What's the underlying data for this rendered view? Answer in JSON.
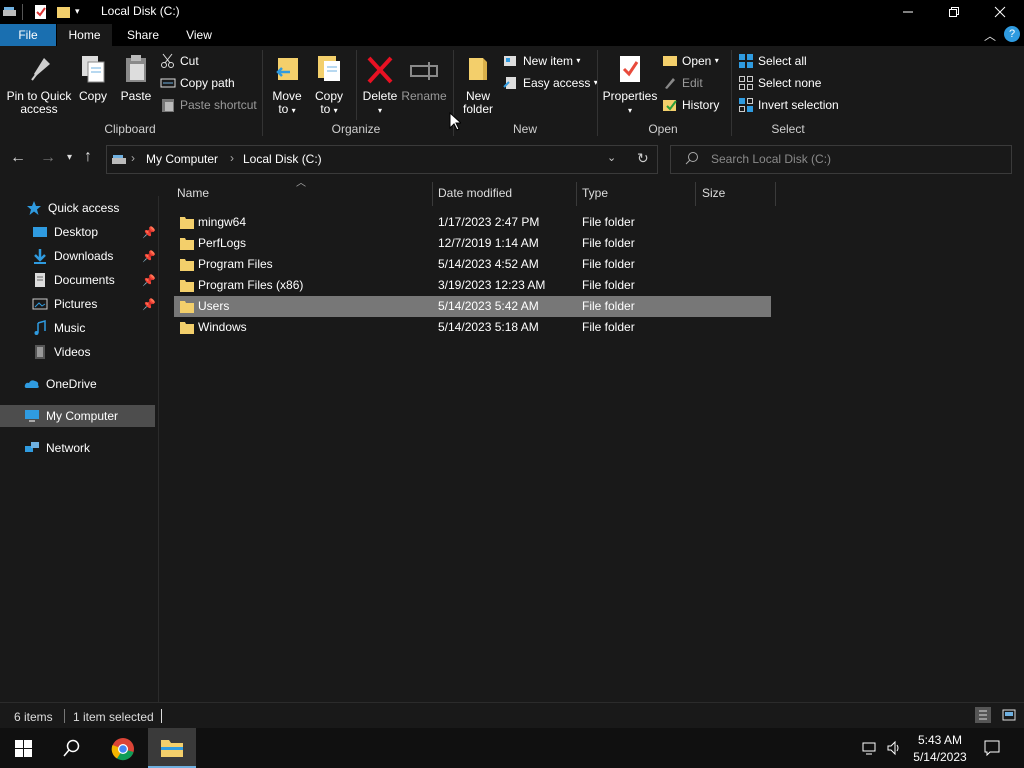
{
  "window": {
    "title": "Local Disk (C:)"
  },
  "tabs": [
    {
      "label": "File"
    },
    {
      "label": "Home"
    },
    {
      "label": "Share"
    },
    {
      "label": "View"
    }
  ],
  "ribbon": {
    "clipboard": {
      "pin_label_1": "Pin to Quick",
      "pin_label_2": "access",
      "copy_label": "Copy",
      "paste_label": "Paste",
      "cut_label": "Cut",
      "copy_path_label": "Copy path",
      "paste_shortcut_label": "Paste shortcut",
      "group_label": "Clipboard"
    },
    "organize": {
      "move_label_1": "Move",
      "move_label_2": "to",
      "copyto_label_1": "Copy",
      "copyto_label_2": "to",
      "delete_label": "Delete",
      "rename_label": "Rename",
      "group_label": "Organize"
    },
    "new": {
      "new_folder_label_1": "New",
      "new_folder_label_2": "folder",
      "new_item_label": "New item",
      "easy_access_label": "Easy access",
      "group_label": "New"
    },
    "open": {
      "properties_label": "Properties",
      "open_label": "Open",
      "edit_label": "Edit",
      "history_label": "History",
      "group_label": "Open"
    },
    "select": {
      "select_all_label": "Select all",
      "select_none_label": "Select none",
      "invert_label": "Invert selection",
      "group_label": "Select"
    }
  },
  "address": {
    "crumbs": [
      "My Computer",
      "Local Disk (C:)"
    ],
    "search_placeholder": "Search Local Disk (C:)"
  },
  "sidebar": {
    "items": [
      {
        "label": "Quick access",
        "icon": "star-icon"
      },
      {
        "label": "Desktop",
        "icon": "desktop-icon"
      },
      {
        "label": "Downloads",
        "icon": "download-icon"
      },
      {
        "label": "Documents",
        "icon": "documents-icon"
      },
      {
        "label": "Pictures",
        "icon": "pictures-icon"
      },
      {
        "label": "Music",
        "icon": "music-icon"
      },
      {
        "label": "Videos",
        "icon": "videos-icon"
      },
      {
        "label": "OneDrive",
        "icon": "cloud-icon"
      },
      {
        "label": "My Computer",
        "icon": "computer-icon"
      },
      {
        "label": "Network",
        "icon": "network-icon"
      }
    ]
  },
  "columns": [
    "Name",
    "Date modified",
    "Type",
    "Size"
  ],
  "files": [
    {
      "name": "mingw64",
      "date": "1/17/2023 2:47 PM",
      "type": "File folder",
      "size": ""
    },
    {
      "name": "PerfLogs",
      "date": "12/7/2019 1:14 AM",
      "type": "File folder",
      "size": ""
    },
    {
      "name": "Program Files",
      "date": "5/14/2023 4:52 AM",
      "type": "File folder",
      "size": ""
    },
    {
      "name": "Program Files (x86)",
      "date": "3/19/2023 12:23 AM",
      "type": "File folder",
      "size": ""
    },
    {
      "name": "Users",
      "date": "5/14/2023 5:42 AM",
      "type": "File folder",
      "size": ""
    },
    {
      "name": "Windows",
      "date": "5/14/2023 5:18 AM",
      "type": "File folder",
      "size": ""
    }
  ],
  "status": {
    "item_count": "6 items",
    "selected": "1 item selected"
  },
  "taskbar": {
    "time": "5:43 AM",
    "date": "5/14/2023"
  },
  "colors": {
    "file_tab": "#1a6fb0",
    "selection": "#777777",
    "folder": "#f3cf6b",
    "accent_blue": "#2f9be0"
  }
}
